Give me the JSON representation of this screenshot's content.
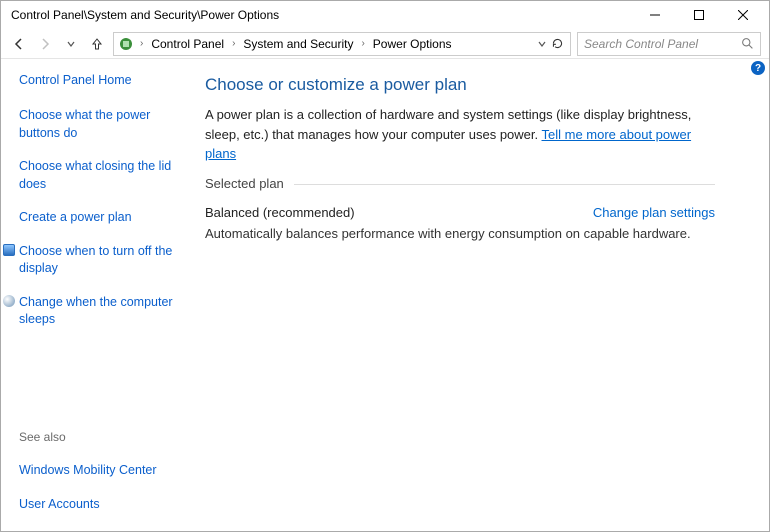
{
  "window": {
    "title": "Control Panel\\System and Security\\Power Options"
  },
  "breadcrumbs": {
    "b0": "Control Panel",
    "b1": "System and Security",
    "b2": "Power Options"
  },
  "search": {
    "placeholder": "Search Control Panel"
  },
  "sidebar": {
    "home": "Control Panel Home",
    "l0": "Choose what the power buttons do",
    "l1": "Choose what closing the lid does",
    "l2": "Create a power plan",
    "l3": "Choose when to turn off the display",
    "l4": "Change when the computer sleeps"
  },
  "seealso": {
    "title": "See also",
    "s0": "Windows Mobility Center",
    "s1": "User Accounts"
  },
  "main": {
    "heading": "Choose or customize a power plan",
    "intro": "A power plan is a collection of hardware and system settings (like display brightness, sleep, etc.) that manages how your computer uses power. ",
    "learn": "Tell me more about power plans",
    "selectedPlanLabel": "Selected plan",
    "planName": "Balanced (recommended)",
    "changePlan": "Change plan settings",
    "planDesc": "Automatically balances performance with energy consumption on capable hardware."
  },
  "help": {
    "symbol": "?"
  }
}
